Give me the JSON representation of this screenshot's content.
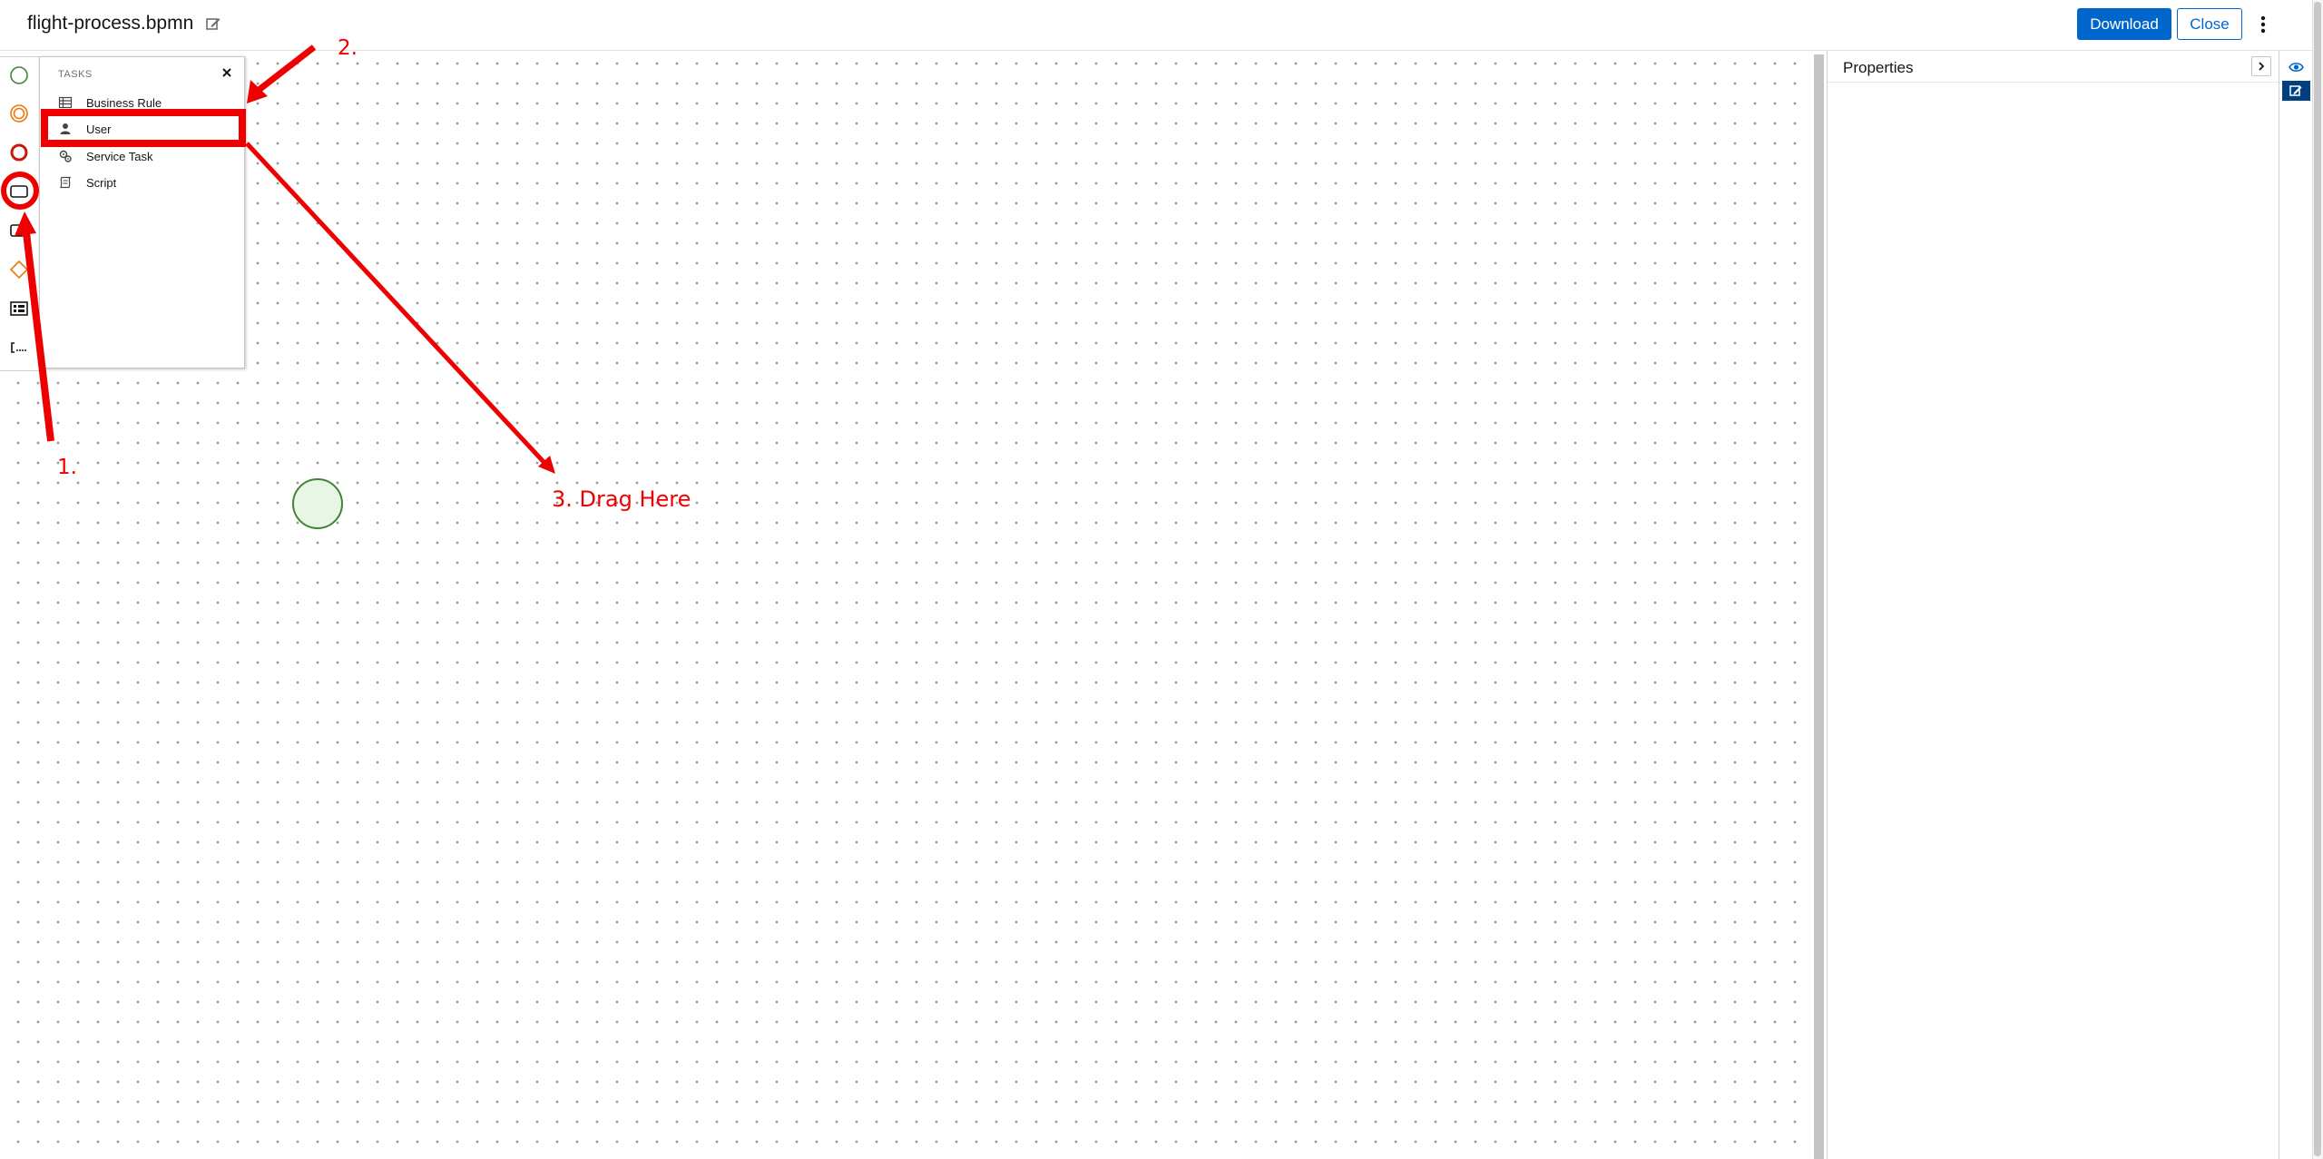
{
  "header": {
    "title": "flight-process.bpmn",
    "download_label": "Download",
    "close_label": "Close"
  },
  "palette": {
    "items": [
      {
        "name": "start-event",
        "icon": "circle-green-icon"
      },
      {
        "name": "intermediate-event",
        "icon": "double-circle-orange-icon"
      },
      {
        "name": "end-event",
        "icon": "circle-red-icon"
      },
      {
        "name": "tasks",
        "icon": "rounded-rect-icon"
      },
      {
        "name": "subprocess",
        "icon": "subprocess-icon"
      },
      {
        "name": "gateway",
        "icon": "diamond-orange-icon"
      },
      {
        "name": "lanes",
        "icon": "lane-icon"
      },
      {
        "name": "artifacts",
        "icon": "annotation-icon"
      }
    ]
  },
  "flyout": {
    "title": "TASKS",
    "items": [
      {
        "label": "Business Rule",
        "icon": "table-icon"
      },
      {
        "label": "User",
        "icon": "user-icon"
      },
      {
        "label": "Service Task",
        "icon": "gears-icon"
      },
      {
        "label": "Script",
        "icon": "script-icon"
      }
    ]
  },
  "properties": {
    "title": "Properties"
  },
  "annotations": {
    "step1": "1.",
    "step2": "2.",
    "step3": "3. Drag Here"
  },
  "colors": {
    "primary": "#0066cc",
    "annotation": "#ee0000",
    "start_event_stroke": "#3e8635",
    "start_event_fill": "#e9f5e5",
    "gateway": "#ec7a08",
    "end_event": "#c9190b",
    "panel_toggle_active": "#004080"
  }
}
